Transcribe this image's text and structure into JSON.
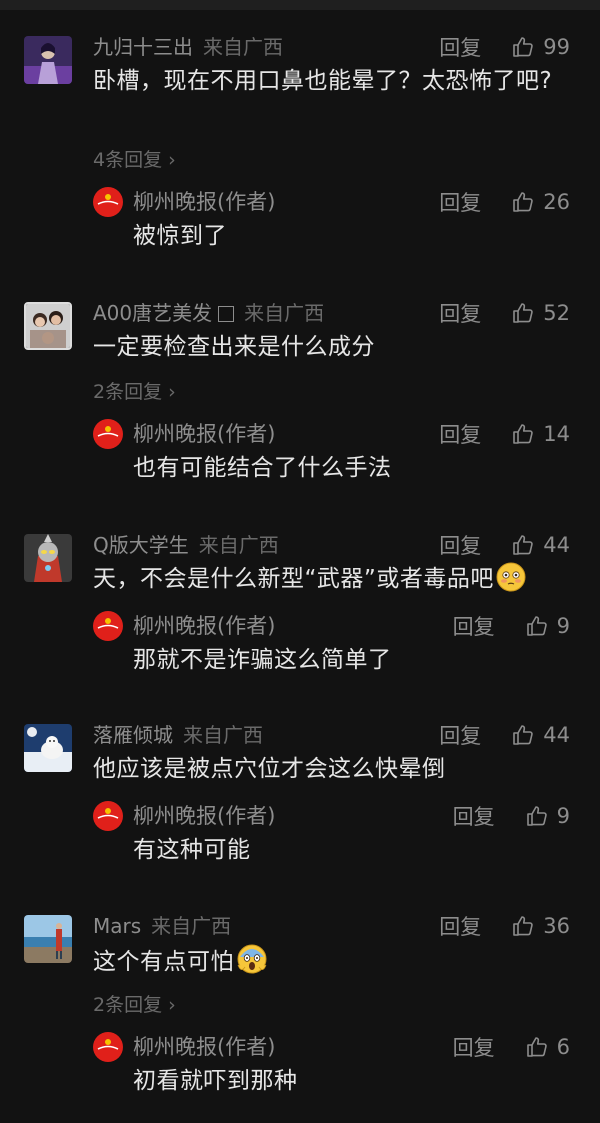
{
  "comments": [
    {
      "user": "九归十三出",
      "location": "来自广西",
      "reply_label": "回复",
      "likes": "99",
      "text": "卧槽，现在不用口鼻也能晕了？太恐怖了吧?",
      "more_replies": "4条回复",
      "author_reply": {
        "name": "柳州晚报(作者)",
        "reply_label": "回复",
        "likes": "26",
        "text": "被惊到了"
      }
    },
    {
      "user": "A00唐艺美发",
      "location": "来自广西",
      "reply_label": "回复",
      "likes": "52",
      "text": "一定要检查出来是什么成分",
      "more_replies": "2条回复",
      "author_reply": {
        "name": "柳州晚报(作者)",
        "reply_label": "回复",
        "likes": "14",
        "text": "也有可能结合了什么手法"
      }
    },
    {
      "user": "Q版大学生",
      "location": "来自广西",
      "reply_label": "回复",
      "likes": "44",
      "text": "天，不会是什么新型“武器”或者毒品吧",
      "author_reply": {
        "name": "柳州晚报(作者)",
        "reply_label": "回复",
        "likes": "9",
        "text": "那就不是诈骗这么简单了"
      }
    },
    {
      "user": "落雁倾城",
      "location": "来自广西",
      "reply_label": "回复",
      "likes": "44",
      "text": "他应该是被点穴位才会这么快晕倒",
      "author_reply": {
        "name": "柳州晚报(作者)",
        "reply_label": "回复",
        "likes": "9",
        "text": "有这种可能"
      }
    },
    {
      "user": "Mars",
      "location": "来自广西",
      "reply_label": "回复",
      "likes": "36",
      "text": "这个有点可怕",
      "more_replies": "2条回复",
      "author_reply": {
        "name": "柳州晚报(作者)",
        "reply_label": "回复",
        "likes": "6",
        "text": "初看就吓到那种"
      }
    }
  ],
  "icons": {
    "like": "thumbs-up-icon",
    "chevron": "chevron-right-icon",
    "emoji_flushed": "flushed-face-emoji-icon",
    "emoji_scream": "screaming-face-emoji-icon",
    "author_logo": "liuzhou-evening-news-logo-icon"
  },
  "colors": {
    "background": "#121212",
    "text_primary": "#e6e6e6",
    "text_secondary": "#8d8d8d",
    "text_tertiary": "#6a6a6a",
    "logo_red": "#e0201a"
  }
}
